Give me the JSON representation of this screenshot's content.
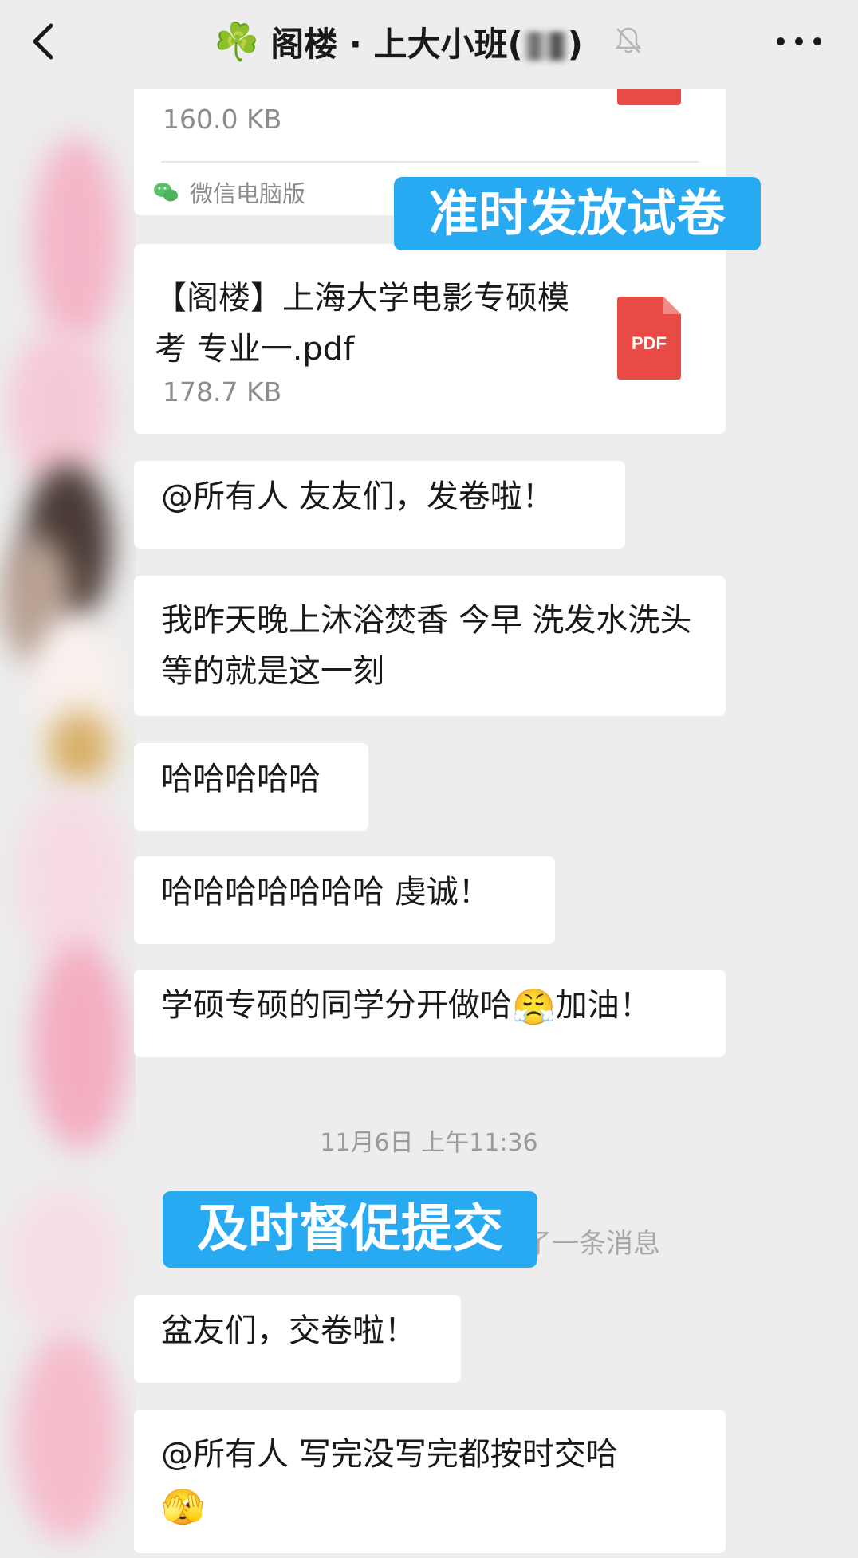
{
  "header": {
    "back_label": "back",
    "clover_glyph": "☘️",
    "title": "阁楼 · 上大小班(",
    "title_suffix": ")",
    "muted_icon": "bell-slash-icon",
    "more_icon": "more-icon"
  },
  "messages": {
    "file_1": {
      "size": "160.0 KB",
      "source": "微信电脑版"
    },
    "file_2": {
      "name": "【阁楼】上海大学电影专硕模考 专业一.pdf",
      "size": "178.7 KB",
      "icon_label": "PDF"
    },
    "msg_1": "@所有人  友友们，发卷啦！",
    "msg_2": "我昨天晚上沐浴焚香 今早 洗发水洗头 等的就是这一刻",
    "msg_3": "哈哈哈哈哈",
    "msg_4": "哈哈哈哈哈哈哈 虔诚！",
    "msg_5_prefix": "学硕专硕的同学分开做哈",
    "msg_5_emoji": "😤",
    "msg_5_suffix": "加油！",
    "timestamp": "11月6日 上午11:36",
    "recall_text": "了一条消息",
    "msg_6": "盆友们，交卷啦！",
    "msg_7": "@所有人  写完没写完都按时交哈",
    "msg_7_emoji": "🫣"
  },
  "annotations": {
    "banner_1": "准时发放试卷",
    "banner_2": "及时督促提交"
  },
  "colors": {
    "background": "#ededed",
    "bubble": "#ffffff",
    "banner": "#28aaf2",
    "pdf_red": "#e84b45"
  }
}
